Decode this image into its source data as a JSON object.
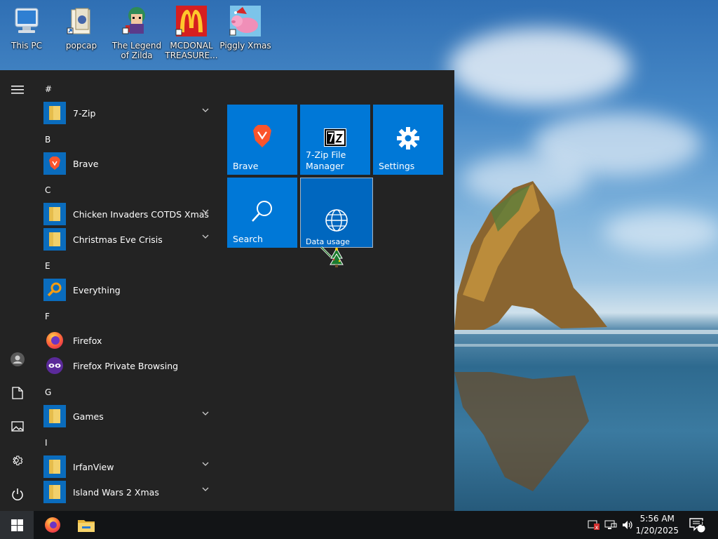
{
  "desktop": {
    "icons": [
      {
        "label": "This PC",
        "icon": "this-pc-icon"
      },
      {
        "label": "popcap",
        "icon": "folder-shortcut-icon"
      },
      {
        "label": "The Legend of Zilda",
        "icon": "game-icon"
      },
      {
        "label": "MCDONAL TREASURE...",
        "icon": "mcdonalds-icon"
      },
      {
        "label": "Piggly Xmas",
        "icon": "pig-icon"
      }
    ]
  },
  "start_menu": {
    "groups": [
      {
        "letter": "#",
        "apps": [
          {
            "label": "7-Zip",
            "icon": "folder-icon",
            "expandable": true
          }
        ]
      },
      {
        "letter": "B",
        "apps": [
          {
            "label": "Brave",
            "icon": "brave-icon",
            "expandable": false
          }
        ]
      },
      {
        "letter": "C",
        "apps": [
          {
            "label": "Chicken Invaders COTDS Xmas",
            "icon": "folder-icon",
            "expandable": true
          },
          {
            "label": "Christmas Eve Crisis",
            "icon": "folder-icon",
            "expandable": true
          }
        ]
      },
      {
        "letter": "E",
        "apps": [
          {
            "label": "Everything",
            "icon": "search-magnifier-icon",
            "expandable": false
          }
        ]
      },
      {
        "letter": "F",
        "apps": [
          {
            "label": "Firefox",
            "icon": "firefox-icon",
            "expandable": false
          },
          {
            "label": "Firefox Private Browsing",
            "icon": "firefox-private-icon",
            "expandable": false
          }
        ]
      },
      {
        "letter": "G",
        "apps": [
          {
            "label": "Games",
            "icon": "folder-icon",
            "expandable": true
          }
        ]
      },
      {
        "letter": "I",
        "apps": [
          {
            "label": "IrfanView",
            "icon": "folder-icon",
            "expandable": true
          },
          {
            "label": "Island Wars 2 Xmas",
            "icon": "folder-icon",
            "expandable": true
          }
        ]
      }
    ],
    "tiles": [
      {
        "label": "Brave",
        "icon": "brave-icon"
      },
      {
        "label": "7-Zip File Manager",
        "label_line1": "7-Zip File",
        "label_line2": "Manager",
        "icon": "7zip-icon"
      },
      {
        "label": "Settings",
        "icon": "gear-icon"
      },
      {
        "label": "Search",
        "icon": "search-icon"
      },
      {
        "label": "Data usage",
        "icon": "globe-icon"
      }
    ],
    "rail": [
      "menu-icon",
      "user-icon",
      "documents-icon",
      "pictures-icon",
      "settings-icon",
      "power-icon"
    ]
  },
  "taskbar": {
    "pinned": [
      "windows-start-icon",
      "firefox-icon",
      "file-explorer-icon"
    ],
    "tray": [
      "security-alert-icon",
      "network-icon",
      "volume-icon"
    ],
    "time": "5:56 AM",
    "date": "1/20/2025",
    "notification_count": "1"
  },
  "colors": {
    "tile_blue": "#0078d7",
    "start_bg": "#232323",
    "taskbar_bg": "#121416",
    "folder_yellow": "#f2d06b"
  }
}
